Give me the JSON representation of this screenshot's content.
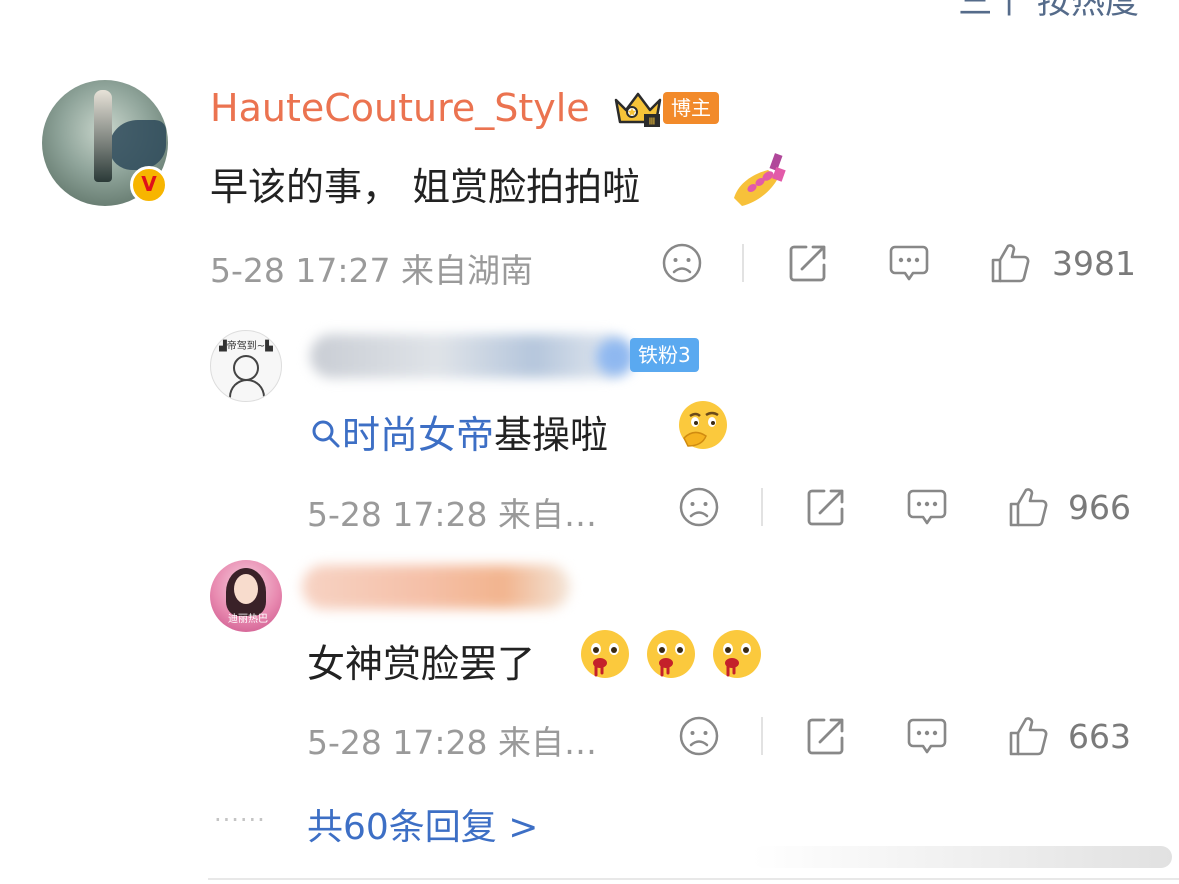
{
  "header": {
    "sort_label": "三个 按热度"
  },
  "main_comment": {
    "username": "HauteCouture_Style",
    "badge_crown_level": "Ⅲ",
    "badge_tag": "博主",
    "verified_badge": "V",
    "text": "早该的事， 姐赏脸拍拍啦",
    "emoji": "nail-polish-icon",
    "timestamp": "5-28 17:27",
    "location": "来自湖南",
    "likes": "3981"
  },
  "replies": [
    {
      "username_blurred": true,
      "fan_badge": "铁粉3",
      "search_link": "时尚女帝",
      "text": "基操啦",
      "emoji": "thinking-face-icon",
      "timestamp": "5-28 17:28",
      "location": "来自…",
      "likes": "966"
    },
    {
      "username_blurred": true,
      "text": "女神赏脸罢了",
      "emoji": "drooling-face-icon",
      "timestamp": "5-28 17:28",
      "location": "来自…",
      "likes": "663"
    }
  ],
  "footer": {
    "dots": "······",
    "more_replies": "共60条回复 >"
  },
  "colors": {
    "username": "#eb7350",
    "link": "#3d6fc5",
    "meta": "#9a9a9a",
    "blogger_tag": "#f28a2a",
    "fan_tag": "#5aa9f0"
  }
}
